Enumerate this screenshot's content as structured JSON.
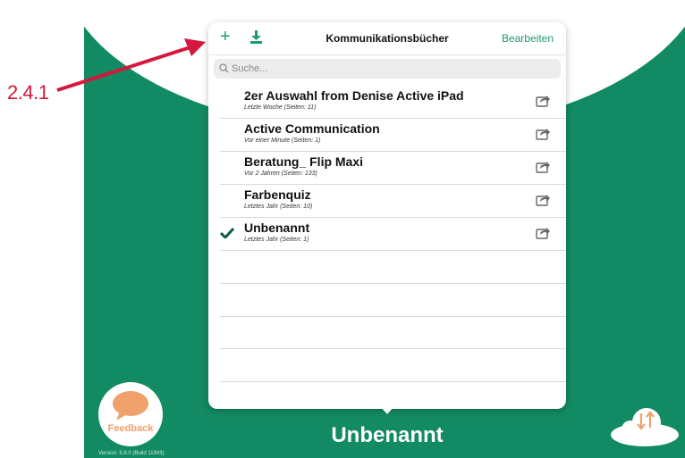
{
  "annotation": {
    "label": "2.4.1",
    "color": "#d4173c"
  },
  "popover": {
    "title": "Kommunikationsbücher",
    "edit_label": "Bearbeiten",
    "add_icon": "plus-icon",
    "import_icon": "download-icon",
    "search": {
      "placeholder": "Suche...",
      "value": ""
    },
    "books": [
      {
        "title": "2er Auswahl from Denise Active iPad",
        "subtitle": "Letzte Woche (Seiten: 11)",
        "selected": false
      },
      {
        "title": "Active Communication",
        "subtitle": "Vor einer Minute (Seiten: 1)",
        "selected": false
      },
      {
        "title": "Beratung_ Flip Maxi",
        "subtitle": "Vor 2 Jahren (Seiten: 133)",
        "selected": false
      },
      {
        "title": "Farbenquiz",
        "subtitle": "Letztes Jahr (Seiten: 10)",
        "selected": false
      },
      {
        "title": "Unbenannt",
        "subtitle": "Letztes Jahr (Seiten: 1)",
        "selected": true
      }
    ]
  },
  "footer": {
    "feedback_label": "Feedback",
    "current_book": "Unbenannt",
    "save_label": "Sichern",
    "version": "Version: 5.8.0 (Build 11943)"
  },
  "colors": {
    "brand_green": "#128a63",
    "accent_green": "#1f9a6b",
    "feedback_orange": "#f0a06a"
  }
}
